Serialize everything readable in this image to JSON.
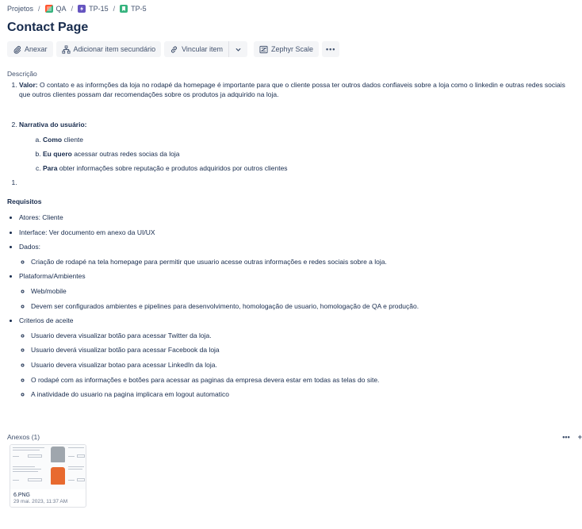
{
  "breadcrumb": {
    "projects": "Projetos",
    "separator": "/",
    "project": "QA",
    "epic": "TP-15",
    "issue": "TP-5"
  },
  "issue": {
    "title": "Contact Page"
  },
  "toolbar": {
    "attach": "Anexar",
    "add_child": "Adicionar item secundário",
    "link": "Vincular item",
    "zephyr": "Zephyr Scale",
    "more": "•••"
  },
  "description": {
    "label": "Descrição",
    "valor_label": "Valor:",
    "valor_text": " O contato e as informções da loja no rodapé da homepage é importante para que o cliente possa ter outros dados confiaveis sobre a loja como o linkedin e outras redes sociais que outros clientes possam dar recomendações sobre os produtos ja adquirido na loja.",
    "narrativa_label": "Narrativa do usuário:",
    "como_label": "Como",
    "como_text": " cliente",
    "quero_label": "Eu quero",
    "quero_text": " acessar outras redes socias da loja",
    "para_label": "Para",
    "para_text": " obter informações sobre reputação e produtos adquiridos por outros clientes"
  },
  "requisitos": {
    "title": "Requisitos",
    "atores": "Atores: Cliente",
    "interface": "Interface: Ver documento em anexo da UI/UX",
    "dados": "Dados:",
    "dados_1": "Criação de rodapé na tela homepage para permitir que usuario acesse outras informações e redes sociais sobre a loja.",
    "plataforma": "Plataforma/Ambientes",
    "plataforma_1": "Web/mobile",
    "plataforma_2": "Devem ser configurados ambientes e pipelines para desenvolvimento, homologação de usuario, homologação de QA e produção.",
    "criterios": "Criterios de aceite",
    "criterios_1": "Usuario devera visualizar botão para acessar Twitter da loja.",
    "criterios_2": "Usuario deverá visualizar botão para acessar Facebook da loja",
    "criterios_3": "Usuario devera visualizar botao para acessar LinkedIn da loja.",
    "criterios_4": "O rodapé com as informações e botões para acessar as paginas da empresa devera estar em todas as telas do site.",
    "criterios_5": "A inatividade do usuario na pagina implicara em logout automatico"
  },
  "attachments": {
    "label": "Anexos (1)",
    "more": "•••",
    "add": "+",
    "file_name": "6.PNG",
    "file_date": "29 mai. 2023, 11:37 AM"
  }
}
